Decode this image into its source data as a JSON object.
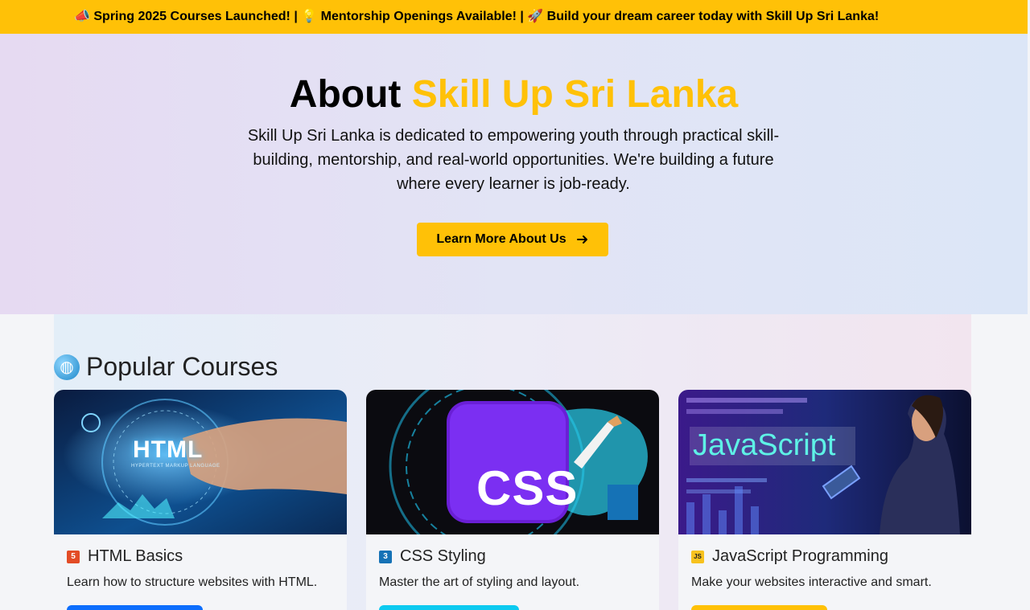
{
  "announcement": "📣 Spring 2025 Courses Launched! | 💡 Mentorship Openings Available! | 🚀 Build your dream career today with Skill Up Sri Lanka!",
  "hero": {
    "title_prefix": "About ",
    "title_accent": "Skill Up Sri Lanka",
    "description": "Skill Up Sri Lanka is dedicated to empowering youth through practical skill-building, mentorship, and real-world opportunities. We're building a future where every learner is job-ready.",
    "button_label": "Learn More About Us",
    "button_icon": "arrow-right-icon"
  },
  "courses": {
    "section_title": "Popular Courses",
    "section_icon": "globe-icon",
    "items": [
      {
        "title": "HTML Basics",
        "description": "Learn how to structure websites with HTML.",
        "icon": "html5-icon",
        "icon_color": "#e34c26",
        "image_text": "HTML",
        "image_subtext": "HYPERTEXT MARKUP LANGUAGE",
        "button_color": "#0d6efd"
      },
      {
        "title": "CSS Styling",
        "description": "Master the art of styling and layout.",
        "icon": "css3-icon",
        "icon_color": "#1572b6",
        "image_text": "CSS",
        "button_color": "#0dcaf0"
      },
      {
        "title": "JavaScript Programming",
        "description": "Make your websites interactive and smart.",
        "icon": "javascript-icon",
        "icon_color": "#f7df1e",
        "image_text": "JavaScript",
        "button_color": "#ffc107"
      }
    ]
  },
  "colors": {
    "accent": "#ffc107",
    "announcement_bg": "#ffc107"
  }
}
